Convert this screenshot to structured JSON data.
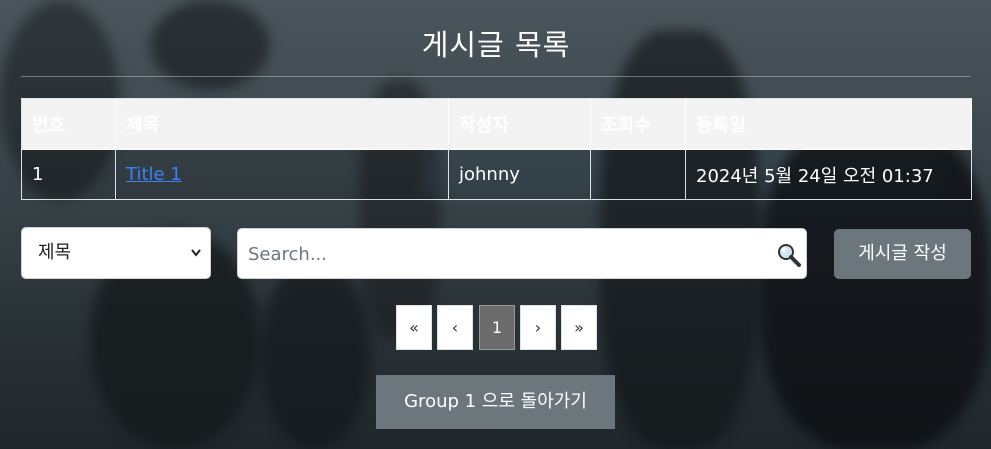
{
  "page": {
    "title": "게시글 목록"
  },
  "table": {
    "headers": [
      "번호",
      "제목",
      "작성자",
      "조회수",
      "등록일"
    ],
    "rows": [
      {
        "number": "1",
        "title": "Title 1",
        "author": "johnny",
        "views": "",
        "date": "2024년 5월 24일 오전 01:37"
      }
    ]
  },
  "search": {
    "field_selected": "제목",
    "placeholder": "Search...",
    "icon": "magnifier-icon",
    "write_label": "게시글 작성"
  },
  "pagination": {
    "first": "«",
    "prev": "‹",
    "current": "1",
    "next": "›",
    "last": "»"
  },
  "footer": {
    "back_label": "Group 1 으로 돌아가기"
  },
  "colors": {
    "link": "#3b82f6",
    "button": "#6c767d",
    "page_active": "#6c6c6c"
  }
}
